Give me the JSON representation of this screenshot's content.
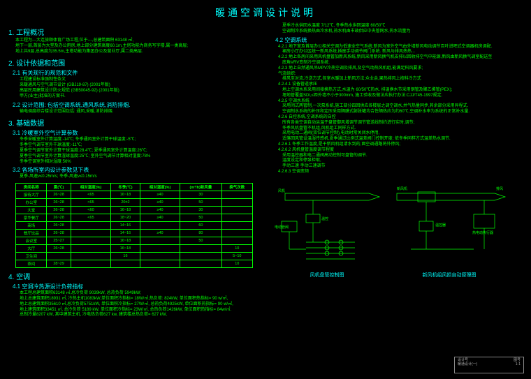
{
  "title": "暖通空调设计说明",
  "left": {
    "s1": {
      "h": "1. 工程概况",
      "p1": "本工程为---大连旅顺体育广场工程,位于---,总建筑面积 63148 ㎡,",
      "p2": "地下一层,首层为大堂及办公用房,地上部分建筑高度60.1m,主塔功能为商务写字楼,属一类高层;",
      "p3": "地上共9层,总高度为35.5m,主塔功能为集团办公及营业厅,属二类高层."
    },
    "s2": {
      "h": "2. 设计依据和范围",
      "s21": "2.1 有关现行的规范和文件",
      "s21a": "工程建设标准强制性条文",
      "s21b": "采暖通风与空气调节设计    (GBJ19-87)    (2001年版)",
      "s21c": "高层民用建筑设计防火规范  (GB50045-92)  (2001年版)",
      "s21d": "甲方(业主)批准的方案书.",
      "s22": "2.2 设计范围: 包括空调系统,通风系统,消防排烟.",
      "s23": "输电调度综合楼设计范围包括: 通风,采暖,消防排烟."
    },
    "s3": {
      "h": "3. 基础数据",
      "s31": "3.1 冷暖室外空气计算参数",
      "s31a": "冬季采暖室外计算温度:-14℃;  冬季通风室外计算干球温度:-5℃;",
      "s31b": "冬季空气调节室外干球温度:-11℃;",
      "s31c": "夏季空气调节室外计算干球温度:28.4℃;   夏季通风室外计算温度:26℃;",
      "s31d": "夏季空气调节室外计算湿球温度:25℃;   室外空气调节计算相对湿度:78%",
      "s31e": "冬季空调室外相对湿度:56%",
      "s32": "3.2 各场所室内设计参数见下表",
      "s32a": "夏季-风速v≤0.25m/s; 冬季-风速v≤0.15m/s"
    },
    "table": {
      "headers": [
        "房间名称",
        "夏(℃)",
        "相对湿度(%)",
        "冬季(℃)",
        "相对湿度(%)",
        "(m³/h)新风量",
        "换气次数"
      ],
      "rows": [
        [
          "接待大厅",
          "26~28",
          "<65",
          "16~18",
          "≥40",
          "30",
          ""
        ],
        [
          "办公室",
          "26~28",
          "<65",
          "20±2",
          "≥40",
          "50",
          ""
        ],
        [
          "大堂",
          "26~28",
          "<60",
          "16~18",
          "≥40",
          "30",
          ""
        ],
        [
          "豪华餐厅",
          "26~28",
          "<65",
          "18~20",
          "≥40",
          "50",
          ""
        ],
        [
          "商场",
          "26~28",
          "",
          "14~16",
          "",
          "60",
          ""
        ],
        [
          "餐厅饮品",
          "26~28",
          "",
          "14~16",
          "≥40",
          "80",
          ""
        ],
        [
          "会议室",
          "25~27",
          "",
          "16~18",
          "",
          "50",
          ""
        ],
        [
          "大厅",
          "26~28",
          "",
          "16~18",
          "",
          "",
          "10"
        ],
        [
          "卫生间",
          "",
          "",
          "16",
          "",
          "",
          "5~10"
        ],
        [
          "茶间",
          "28~29",
          "",
          "",
          "",
          "",
          "10"
        ]
      ]
    },
    "s4": {
      "h": "4. 空调",
      "s41": "4.1 空调冷热源设计负荷指标",
      "s41a": "本工程总建筑面积63148 ㎡,总冷负荷 9039kW, 总热负荷  5949kW;",
      "s41b": "地上总建筑面积18931 ㎡, 冷热主机1083kW,单位面积冷指标= 18W/㎡,热负荷: 824kW, 单位面积热指标=  90 w/㎡,",
      "s41c": "地上总建筑面积35610 ㎡,总冷负荷5751kW, 单位面积冷指标= 27W/㎡, 总热负荷4925kW, 单位面积热指标= 90 w/㎡,",
      "s41d": "地上建筑面积33451 ㎡, 总冷负荷 5189 kW, 单位面积冷指标= 23W/㎡, 总热负荷1426kW, 单位面积热指标= 84w/㎡.",
      "s41e": "总制冷量8207 kW, 其中建筑主机, 冷电热负荷627 kw,  建筑楼总热负荷= 627 kW,"
    }
  },
  "right": {
    "top1": "夏季冷水供回水温度 7/12℃, 冬季热水供回温度 60/50℃",
    "top2": "空调制冷系统换热由冷水机,热水机由市政供应中央管网水,热水流量为",
    "s42": "4.2 空调系统",
    "s421": "4.2.1 地下室及首层办公相关空调为低速全空气系统,新风为室外空气由外墙新风电动调节百叶进吧式空调器机房调配.",
    "s421a": "裙房小厅办公区统一新风系统,插座手动调节阀门系统. 新风与排风热热...",
    "s422": "4.2.2 地上各房间采用风机盘管加新风系统,新风采用新风换气机安排以回收排空气中能源,新风由新风换气调室配送至",
    "s422a": "底角VRV变制冷空调系统.",
    "s423": "4.2.3 地上自然通风吊MPV冷热空调及排风,及空气动热风机组,能满足科风要求;",
    "s424": "气流组织:",
    "s424a": "排风至对流,冷送方式,各室水暖加上新风方法;众业余,果热排风上按科冷方式",
    "s4241": "4.2.4.1 设备管道承压",
    "s4241a": "地上空调水系采用间接换热方式,水温为 60/50℃热水. 排温换水节采用钢管及聚乙烯管(PEX);",
    "s4241b": "埋地管覆盖SDI,≤距外墙不小于300mm, 施工验收及做法应执行办法:CJJ/T45-1997规定.",
    "s4242": "4.2.5 空调水系统",
    "s4242a": "采用闭式两管制,一次泵系统,施工部分四回供应各楼层之调空调水,并气热量同步,其余部分采用异程式.",
    "s4242b": "空调制水系统的补压和定压采用隔膜式膨胀罐均合性隔热应为约60℃,空调补水率为系统的正常补水量.",
    "s426": "4.2.6 自控系统,空调系统的自控",
    "s426a": "所有各类空调自动运温于盘管御风增调节调节管送线制约进行实时,调节;",
    "s426b": "冬季风机盘管不机组,风机组工同样方式.",
    "s426c": "采用电动二通阀(双位调节控制),电动时常关闭水停用,",
    "s426d": "适落回风管设温湿传感机,夏季通过比例式温差阀门控制开度; 依冬季同样方式温差热水调节.",
    "s4261": "4.2.6.1 冬季工作温度,是干新风机组请水到的,面空调通路将外停风;",
    "s4262": "4.2.6.2 风机盘管温度调节程度",
    "s4262a": "采用温控器和电二通阀高动控制可盘管的调节.",
    "s4262b": "温度设定和停泵检取,",
    "s4262c": "手动三速 手动三速调节",
    "s4263": "4.2.6.3 空调变频",
    "diag1_label": "风机盘管控制图",
    "diag2_label": "新风机组风损自动原理图",
    "diag1_text1": "风机",
    "diag1_text2": "温控",
    "diag1_text3": "电动管阀",
    "diag2_text1": "新风机",
    "diag2_text2": "温控器",
    "diag2_text3": "排风",
    "diag2_text4": "热电动执行器"
  },
  "titleblock": {
    "a": "设计号",
    "b": "图号",
    "c": "暖通设计(一)",
    "d": "1-1"
  }
}
